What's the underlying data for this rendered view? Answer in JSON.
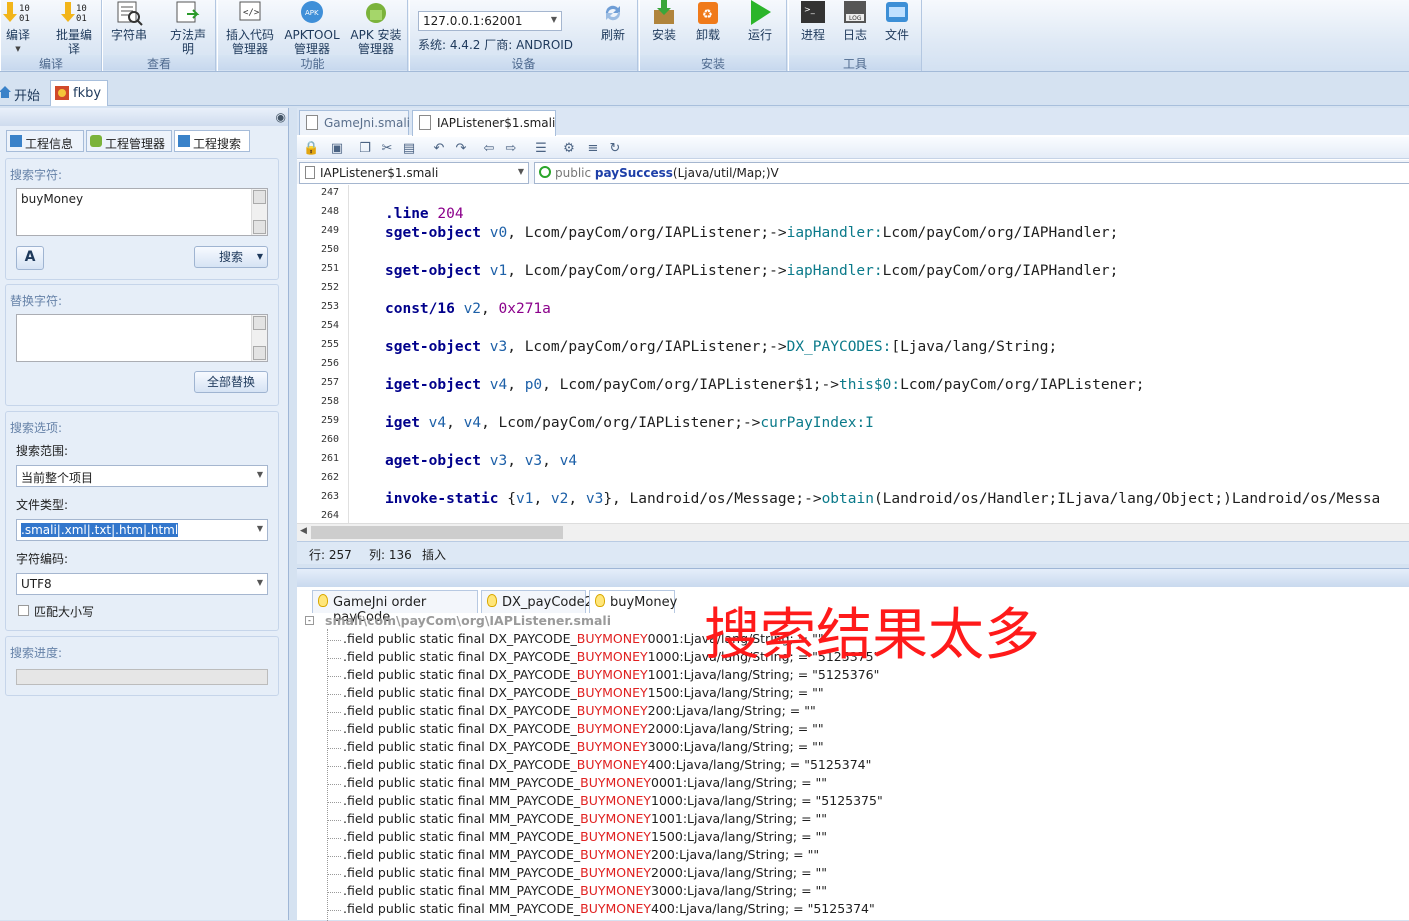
{
  "ribbon": {
    "groups": [
      {
        "title": "编译",
        "buttons": [
          "编译",
          "批量编译"
        ]
      },
      {
        "title": "查看",
        "buttons": [
          "字符串",
          "方法声明"
        ]
      },
      {
        "title": "功能",
        "buttons": [
          "插入代码管理器",
          "APKTOOL管理器",
          "APK 安装管理器"
        ]
      },
      {
        "title": "设备",
        "device_value": "127.0.0.1:62001",
        "system_info": "系统: 4.4.2  厂商: ANDROID",
        "button": "刷新"
      },
      {
        "title": "安装",
        "buttons": [
          "安装",
          "卸载",
          "运行"
        ]
      },
      {
        "title": "工具",
        "buttons": [
          "进程",
          "日志",
          "文件"
        ]
      }
    ]
  },
  "doc_tabs": [
    "开始",
    "fkby"
  ],
  "left_panel": {
    "tabs": [
      "工程信息",
      "工程管理器",
      "工程搜索"
    ],
    "search_label": "搜索字符:",
    "search_value": "buyMoney",
    "search_button": "搜索",
    "replace_label": "替换字符:",
    "replace_value": "",
    "replace_all_button": "全部替换",
    "options_label": "搜索选项:",
    "scope_label": "搜索范围:",
    "scope_value": "当前整个项目",
    "filetype_label": "文件类型:",
    "filetype_value": ".smali|.xml|.txt|.htm|.html",
    "encoding_label": "字符编码:",
    "encoding_value": "UTF8",
    "match_case_label": "匹配大小写",
    "progress_label": "搜索进度:",
    "progress": 0
  },
  "editor": {
    "tabs": [
      "GameJni.smali",
      "IAPListener$1.smali"
    ],
    "active_tab": 1,
    "file_combo": "IAPListener$1.smali",
    "method_combo_prefix": "public ",
    "method_combo_name": "paySuccess",
    "method_combo_sig": "(Ljava/util/Map;)V",
    "line_numbers": [
      "247",
      "248",
      "249",
      "250",
      "251",
      "252",
      "253",
      "254",
      "255",
      "256",
      "257",
      "258",
      "259",
      "260",
      "261",
      "262",
      "263",
      "264"
    ],
    "status_row": "行: 257",
    "status_col": "列: 136",
    "status_mode": "插入"
  },
  "results": {
    "tabs": [
      "GameJni order payCode",
      "DX_payCode2",
      "buyMoney"
    ],
    "file_path": "smali\\com\\payCom\\org\\IAPListener.smali",
    "rows": [
      {
        "pre": ".field public static final DX_PAYCODE_",
        "hl": "BUYMONEY",
        "post": "0001:Ljava/lang/String; = \"\""
      },
      {
        "pre": ".field public static final DX_PAYCODE_",
        "hl": "BUYMONEY",
        "post": "1000:Ljava/lang/String; = \"5125375\""
      },
      {
        "pre": ".field public static final DX_PAYCODE_",
        "hl": "BUYMONEY",
        "post": "1001:Ljava/lang/String; = \"5125376\""
      },
      {
        "pre": ".field public static final DX_PAYCODE_",
        "hl": "BUYMONEY",
        "post": "1500:Ljava/lang/String; = \"\""
      },
      {
        "pre": ".field public static final DX_PAYCODE_",
        "hl": "BUYMONEY",
        "post": "200:Ljava/lang/String; = \"\""
      },
      {
        "pre": ".field public static final DX_PAYCODE_",
        "hl": "BUYMONEY",
        "post": "2000:Ljava/lang/String; = \"\""
      },
      {
        "pre": ".field public static final DX_PAYCODE_",
        "hl": "BUYMONEY",
        "post": "3000:Ljava/lang/String; = \"\""
      },
      {
        "pre": ".field public static final DX_PAYCODE_",
        "hl": "BUYMONEY",
        "post": "400:Ljava/lang/String; = \"5125374\""
      },
      {
        "pre": ".field public static final MM_PAYCODE_",
        "hl": "BUYMONEY",
        "post": "0001:Ljava/lang/String; = \"\""
      },
      {
        "pre": ".field public static final MM_PAYCODE_",
        "hl": "BUYMONEY",
        "post": "1000:Ljava/lang/String; = \"5125375\""
      },
      {
        "pre": ".field public static final MM_PAYCODE_",
        "hl": "BUYMONEY",
        "post": "1001:Ljava/lang/String; = \"\""
      },
      {
        "pre": ".field public static final MM_PAYCODE_",
        "hl": "BUYMONEY",
        "post": "1500:Ljava/lang/String; = \"\""
      },
      {
        "pre": ".field public static final MM_PAYCODE_",
        "hl": "BUYMONEY",
        "post": "200:Ljava/lang/String; = \"\""
      },
      {
        "pre": ".field public static final MM_PAYCODE_",
        "hl": "BUYMONEY",
        "post": "2000:Ljava/lang/String; = \"\""
      },
      {
        "pre": ".field public static final MM_PAYCODE_",
        "hl": "BUYMONEY",
        "post": "3000:Ljava/lang/String; = \"\""
      },
      {
        "pre": ".field public static final MM_PAYCODE_",
        "hl": "BUYMONEY",
        "post": "400:Ljava/lang/String; = \"5125374\""
      }
    ]
  },
  "annotation": "搜索结果太多",
  "colors": {
    "highlight": "#e02020",
    "annotation": "#ff1a1a",
    "keyword": "#00008b",
    "register": "#1d60a8",
    "number": "#8b008b",
    "field": "#0b7a8a"
  }
}
